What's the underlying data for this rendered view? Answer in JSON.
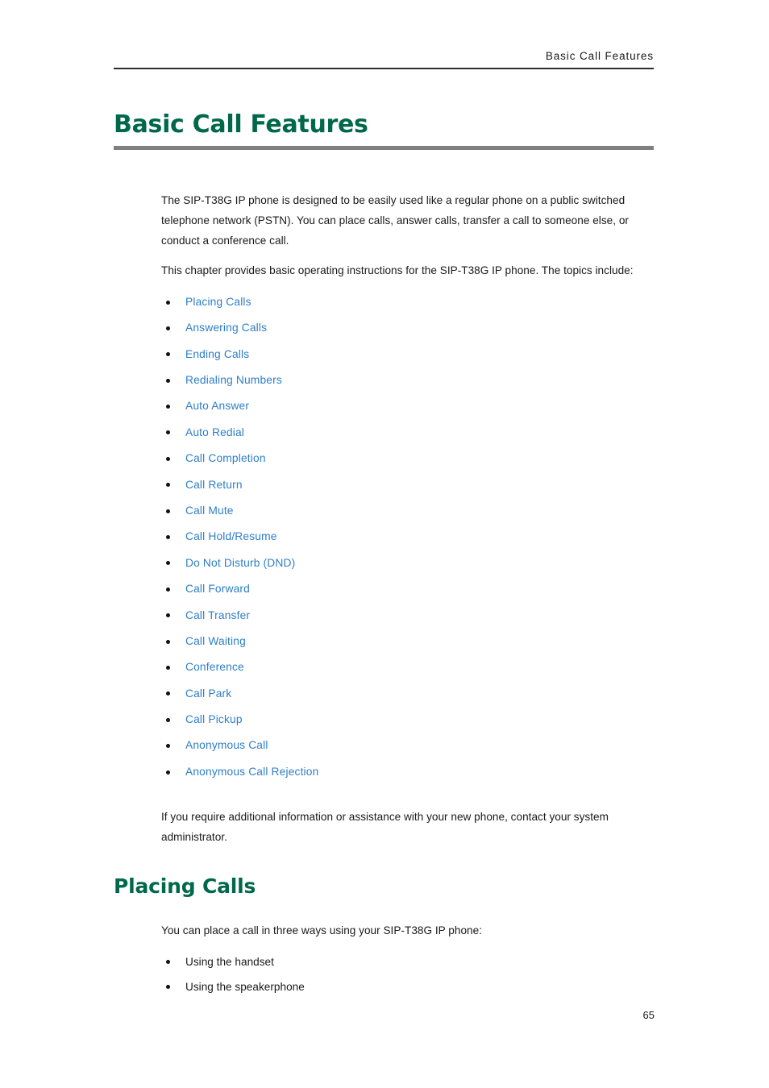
{
  "header": {
    "running_title": "Basic  Call  Features"
  },
  "chapter": {
    "title": "Basic Call Features",
    "intro_paragraph_1": "The SIP-T38G IP phone is designed to be easily used like a regular phone on a public switched telephone network (PSTN). You can place calls, answer calls, transfer a call to someone else, or conduct a conference call.",
    "intro_paragraph_2": "This chapter provides basic operating instructions for the SIP-T38G IP phone. The topics include:",
    "closing_paragraph": "If you require additional information or assistance with your new phone, contact your system administrator."
  },
  "topics": [
    {
      "label": "Placing Calls"
    },
    {
      "label": "Answering Calls"
    },
    {
      "label": "Ending Calls"
    },
    {
      "label": "Redialing Numbers"
    },
    {
      "label": "Auto Answer"
    },
    {
      "label": "Auto Redial"
    },
    {
      "label": "Call Completion"
    },
    {
      "label": "Call Return"
    },
    {
      "label": "Call Mute"
    },
    {
      "label": "Call Hold/Resume"
    },
    {
      "label": "Do Not Disturb (DND)"
    },
    {
      "label": "Call Forward"
    },
    {
      "label": "Call Transfer"
    },
    {
      "label": "Call Waiting"
    },
    {
      "label": "Conference"
    },
    {
      "label": "Call Park"
    },
    {
      "label": "Call Pickup"
    },
    {
      "label": "Anonymous Call"
    },
    {
      "label": "Anonymous Call Rejection"
    }
  ],
  "section": {
    "title": "Placing Calls",
    "intro": "You can place a call in three ways using your SIP-T38G IP phone:",
    "methods": [
      {
        "label": "Using the handset"
      },
      {
        "label": "Using the speakerphone"
      }
    ]
  },
  "footer": {
    "page_number": "65"
  },
  "colors": {
    "heading_green": "#00684A",
    "link_blue": "#2E7EC8",
    "rule_gray": "#808080",
    "body_black": "#1a1a1a"
  }
}
